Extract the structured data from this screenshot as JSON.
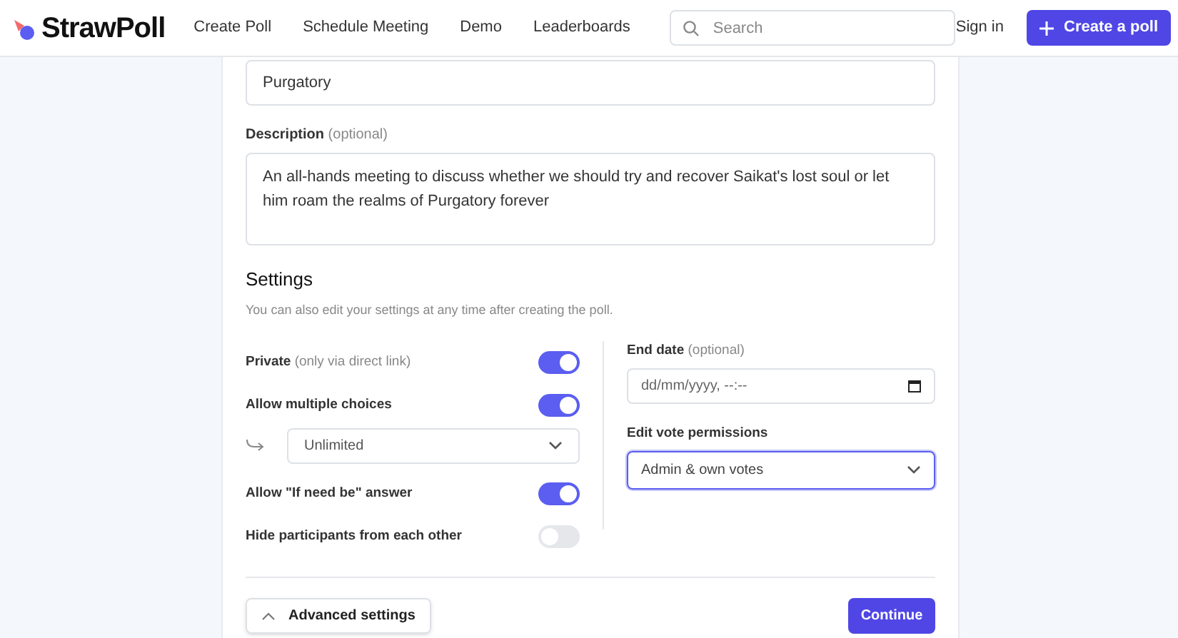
{
  "header": {
    "logo": "StrawPoll",
    "nav": [
      "Create Poll",
      "Schedule Meeting",
      "Demo",
      "Leaderboards"
    ],
    "search": {
      "placeholder": "Search"
    },
    "sign_in": "Sign in",
    "create_button": "Create a poll"
  },
  "form": {
    "title_value": "Purgatory",
    "description": {
      "label": "Description",
      "note": "(optional)",
      "value": "An all-hands meeting to discuss whether we should try and recover Saikat's lost soul or let him roam the realms of Purgatory forever"
    },
    "settings_title": "Settings",
    "settings_subtitle": "You can also edit your settings at any time after creating the poll.",
    "left": [
      {
        "kind": "toggle",
        "label": "Private",
        "note": "(only via direct link)",
        "on": true
      },
      {
        "kind": "toggle",
        "label": "Allow multiple choices",
        "on": true
      },
      {
        "kind": "select",
        "value": "Unlimited"
      },
      {
        "kind": "toggle",
        "label": "Allow \"If need be\" answer",
        "on": true
      },
      {
        "kind": "toggle",
        "label": "Hide participants from each other",
        "on": false
      }
    ],
    "end_date": {
      "label": "End date",
      "note": "(optional)",
      "placeholder": "dd/mm/yyyy, --:--"
    },
    "permissions": {
      "label": "Edit vote permissions",
      "value": "Admin & own votes",
      "focused": true
    },
    "advanced_button": "Advanced settings",
    "continue_button": "Continue"
  }
}
